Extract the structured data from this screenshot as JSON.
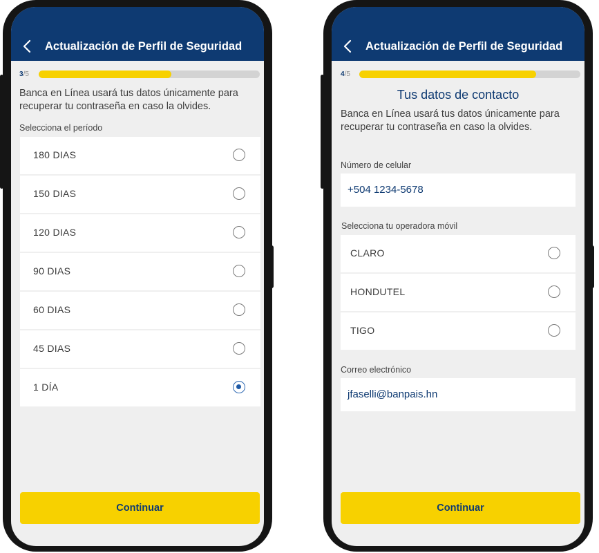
{
  "colors": {
    "appbar": "#0e3a72",
    "accent": "#f7d100",
    "background": "#efefef",
    "radio_selected": "#1f5aa6"
  },
  "left_screen": {
    "title": "Actualización de Perfil de Seguridad",
    "step_current": "3",
    "step_total": "/5",
    "progress_fraction": 0.6,
    "description": "Banca en Línea usará tus datos únicamente para recuperar tu contraseña en caso la olvides.",
    "period_label": "Selecciona el período",
    "periods": [
      {
        "label": "180 DIAS",
        "selected": false
      },
      {
        "label": "150 DIAS",
        "selected": false
      },
      {
        "label": "120 DIAS",
        "selected": false
      },
      {
        "label": "90 DIAS",
        "selected": false
      },
      {
        "label": "60 DIAS",
        "selected": false
      },
      {
        "label": "45 DIAS",
        "selected": false
      },
      {
        "label": "1 DÍA",
        "selected": true
      }
    ],
    "continue_label": "Continuar"
  },
  "right_screen": {
    "title": "Actualización de Perfil de Seguridad",
    "step_current": "4",
    "step_total": "/5",
    "progress_fraction": 0.8,
    "heading": "Tus datos de contacto",
    "description": "Banca en Línea usará tus datos únicamente para recuperar tu contraseña en caso la olvides.",
    "phone_label": "Número de celular",
    "phone_value": "+504  1234-5678",
    "operator_label": "Selecciona tu operadora móvil",
    "operators": [
      {
        "label": "CLARO",
        "selected": false
      },
      {
        "label": "HONDUTEL",
        "selected": false
      },
      {
        "label": "TIGO",
        "selected": false
      }
    ],
    "email_label": "Correo electrónico",
    "email_value": "jfaselli@banpais.hn",
    "continue_label": "Continuar"
  }
}
